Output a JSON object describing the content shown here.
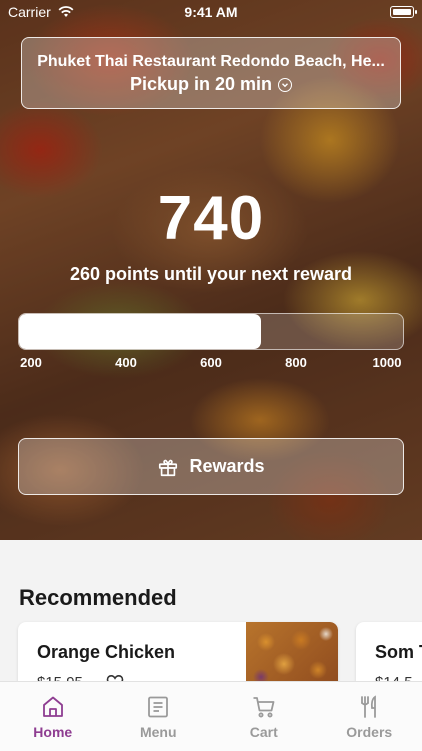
{
  "status_bar": {
    "carrier": "Carrier",
    "time": "9:41 AM"
  },
  "location": {
    "name": "Phuket Thai Restaurant Redondo Beach, He...",
    "pickup": "Pickup in 20 min"
  },
  "rewards": {
    "points": "740",
    "subtitle": "260 points until your next reward",
    "progress_fraction": 0.63,
    "ticks": [
      "200",
      "400",
      "600",
      "800",
      "1000"
    ],
    "button_label": "Rewards"
  },
  "recommended": {
    "title": "Recommended",
    "items": [
      {
        "name": "Orange Chicken",
        "price": "$15.95"
      },
      {
        "name": "Som T",
        "price": "$14.5"
      }
    ]
  },
  "tabs": [
    {
      "label": "Home",
      "icon": "home-icon",
      "active": true
    },
    {
      "label": "Menu",
      "icon": "menu-icon",
      "active": false
    },
    {
      "label": "Cart",
      "icon": "cart-icon",
      "active": false
    },
    {
      "label": "Orders",
      "icon": "orders-icon",
      "active": false
    }
  ],
  "colors": {
    "accent": "#8e3d91",
    "inactive": "#9a9a9a"
  }
}
